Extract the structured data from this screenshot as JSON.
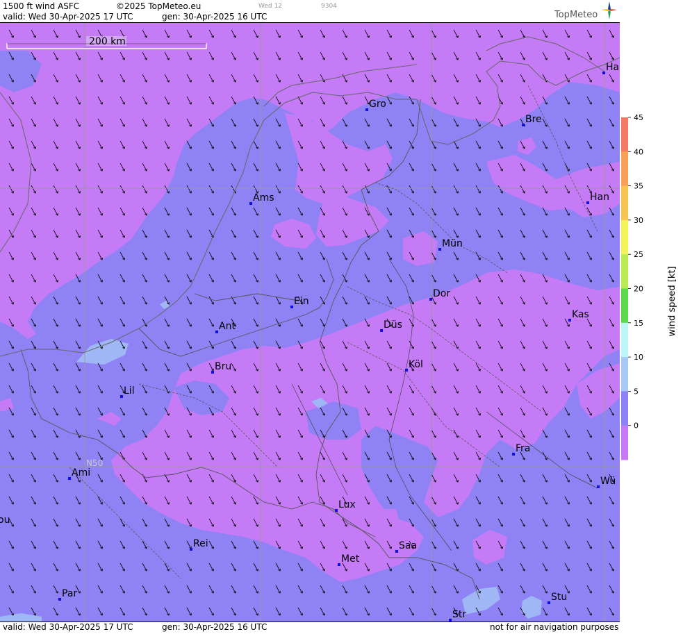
{
  "header": {
    "product": "1500 ft wind ASFC",
    "copyright": "©2025 TopMeteo.eu",
    "valid": "valid:  Wed  30-Apr-2025  17 UTC",
    "generated": "gen: 30-Apr-2025 16 UTC",
    "ghost_day": "Wed 12",
    "ghost_code": "9304",
    "logo": "TopMeteo"
  },
  "map": {
    "scale_label": "200 km",
    "lat_label": "N50",
    "cities": [
      {
        "id": "gro",
        "label": "Gro"
      },
      {
        "id": "bre",
        "label": "Bre"
      },
      {
        "id": "ha",
        "label": "Ha"
      },
      {
        "id": "ams",
        "label": "Ams"
      },
      {
        "id": "han",
        "label": "Han"
      },
      {
        "id": "mun",
        "label": "Mün"
      },
      {
        "id": "ein",
        "label": "Ein"
      },
      {
        "id": "dor",
        "label": "Dor"
      },
      {
        "id": "ant",
        "label": "Ant"
      },
      {
        "id": "dus",
        "label": "Düs"
      },
      {
        "id": "kas",
        "label": "Kas"
      },
      {
        "id": "bru",
        "label": "Bru"
      },
      {
        "id": "kol",
        "label": "Köl"
      },
      {
        "id": "lil",
        "label": "Lil"
      },
      {
        "id": "fra",
        "label": "Fra"
      },
      {
        "id": "ami",
        "label": "Ami"
      },
      {
        "id": "wu",
        "label": "Wü"
      },
      {
        "id": "lux",
        "label": "Lux"
      },
      {
        "id": "ou",
        "label": "ou"
      },
      {
        "id": "rei",
        "label": "Rei"
      },
      {
        "id": "saa",
        "label": "Saa"
      },
      {
        "id": "met",
        "label": "Met"
      },
      {
        "id": "par",
        "label": "Par"
      },
      {
        "id": "stu",
        "label": "Stu"
      },
      {
        "id": "str",
        "label": "Str"
      }
    ]
  },
  "footer": {
    "valid": "valid:  Wed  30-Apr-2025  17 UTC",
    "generated": "gen: 30-Apr-2025 16 UTC",
    "disclaimer": "not for air navigation purposes"
  },
  "legend": {
    "title": "wind speed [kt]",
    "ticks": [
      "45",
      "40",
      "35",
      "30",
      "25",
      "20",
      "15",
      "10",
      "5",
      "0"
    ],
    "colors": [
      "#f47a64",
      "#f6a05a",
      "#f8c34e",
      "#f4f25a",
      "#b8ec52",
      "#5cd84c",
      "#bdf6f8",
      "#a8c8f6",
      "#8c82f6",
      "#c87af6"
    ]
  }
}
